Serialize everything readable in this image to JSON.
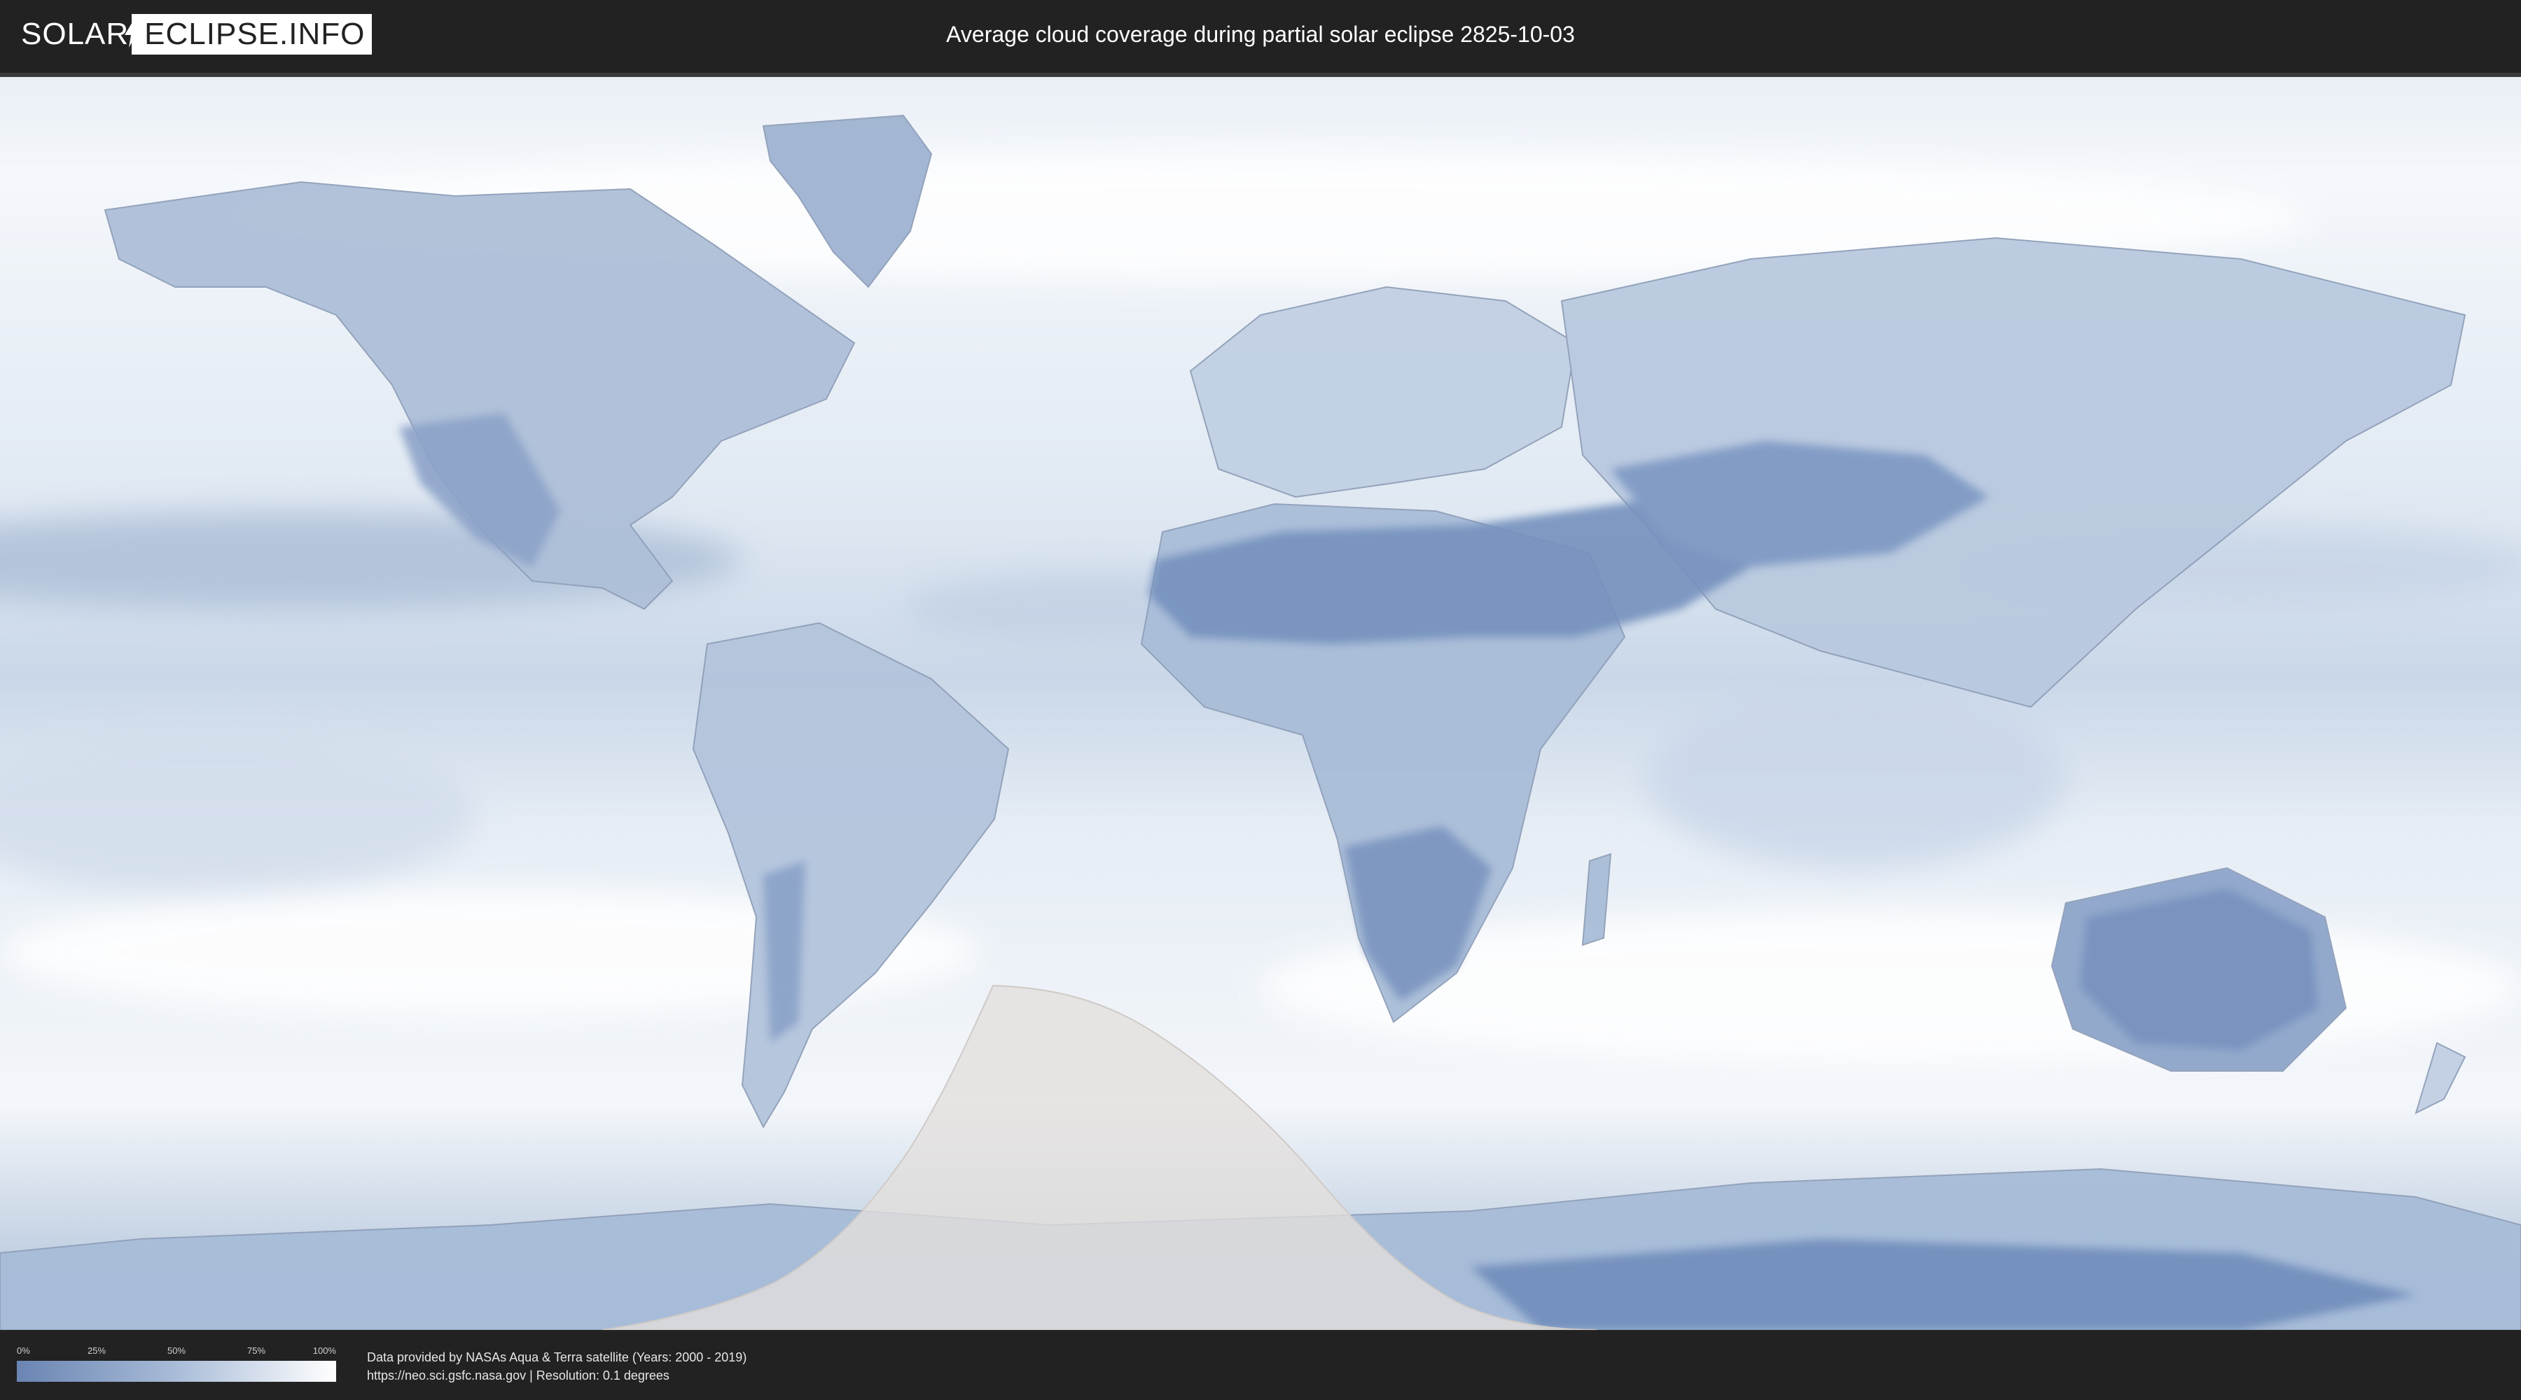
{
  "header": {
    "logo_left": "SOLAR",
    "logo_right": "ECLIPSE.INFO",
    "title": "Average cloud coverage during partial solar eclipse 2825-10-03"
  },
  "legend": {
    "ticks": [
      "0%",
      "25%",
      "50%",
      "75%",
      "100%"
    ],
    "fractions": [
      0,
      0.25,
      0.5,
      0.75,
      1
    ],
    "color_low": "#6a85b3",
    "color_high": "#ffffff"
  },
  "footer": {
    "line1": "Data provided by NASAs Aqua & Terra satellite (Years: 2000 - 2019)",
    "line2": "https://neo.sci.gsfc.nasa.gov | Resolution: 0.1 degrees"
  },
  "colors": {
    "background": "#222222",
    "ocean_cloud": "#dde6f1",
    "land_clear": "#7590bd",
    "eclipse_zone": "#e4e1df"
  }
}
